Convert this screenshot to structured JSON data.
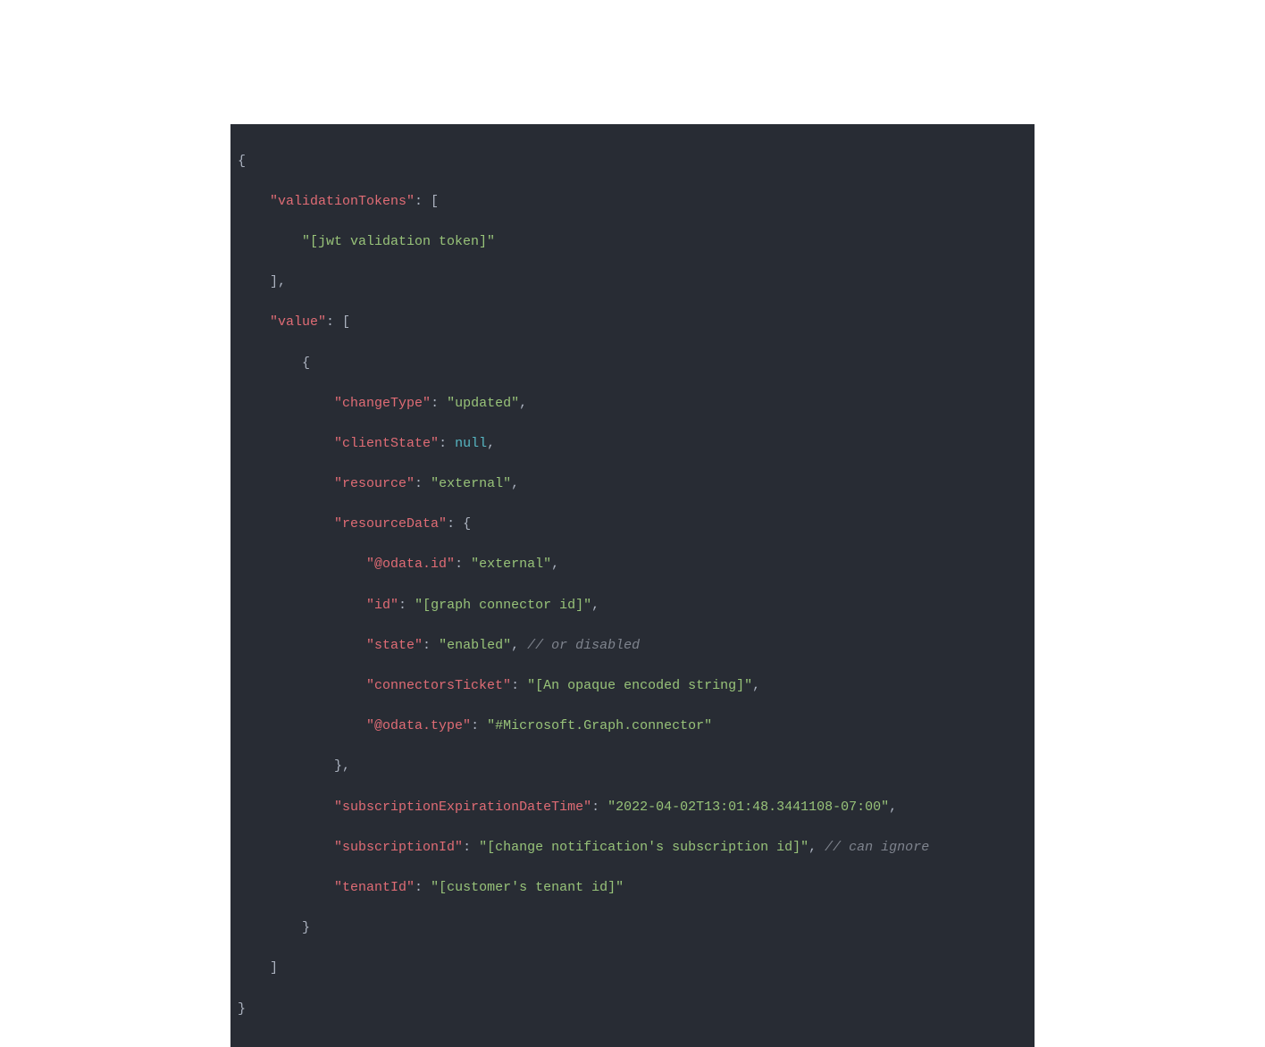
{
  "code": {
    "keys": {
      "validationTokens": "\"validationTokens\"",
      "value": "\"value\"",
      "changeType": "\"changeType\"",
      "clientState": "\"clientState\"",
      "resource": "\"resource\"",
      "resourceData": "\"resourceData\"",
      "odataId": "\"@odata.id\"",
      "id": "\"id\"",
      "state": "\"state\"",
      "connectorsTicket": "\"connectorsTicket\"",
      "odataType": "\"@odata.type\"",
      "subscriptionExpirationDateTime": "\"subscriptionExpirationDateTime\"",
      "subscriptionId": "\"subscriptionId\"",
      "tenantId": "\"tenantId\""
    },
    "values": {
      "jwtToken": "\"[jwt validation token]\"",
      "updated": "\"updated\"",
      "null": "null",
      "external": "\"external\"",
      "external2": "\"external\"",
      "graphConnectorId": "\"[graph connector id]\"",
      "enabled": "\"enabled\"",
      "opaqueString": "\"[An opaque encoded string]\"",
      "connectorType": "\"#Microsoft.Graph.connector\"",
      "expirationDate": "\"2022-04-02T13:01:48.3441108-07:00\"",
      "subscriptionIdVal": "\"[change notification's subscription id]\"",
      "tenantIdVal": "\"[customer's tenant id]\""
    },
    "comments": {
      "orDisabled": "// or disabled",
      "canIgnore": "// can ignore"
    },
    "punct": {
      "openBrace": "{",
      "closeBrace": "}",
      "openBracket": "[",
      "closeBracket": "]",
      "colon": ": ",
      "colonBracket": ": [",
      "colonBrace": ": {",
      "comma": ",",
      "closeBracketComma": "],",
      "closeBraceComma": "},"
    }
  }
}
